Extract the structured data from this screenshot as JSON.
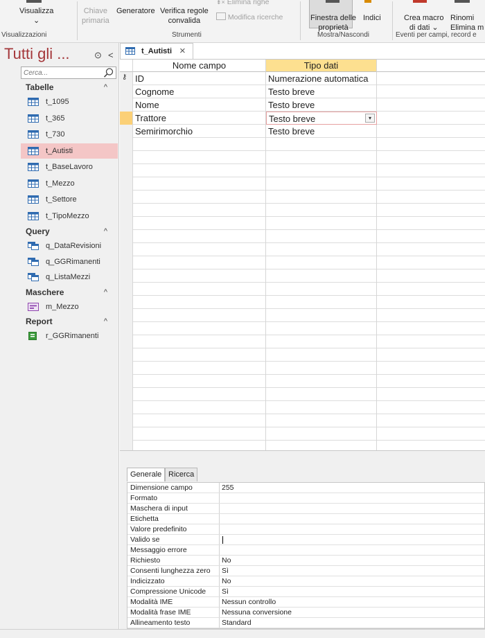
{
  "ribbon": {
    "visualizza": "Visualizza",
    "visualizza_arrow": "⌄",
    "chiave_line1": "Chiave",
    "chiave_line2": "primaria",
    "generatore": "Generatore",
    "verifica_line1": "Verifica regole",
    "verifica_line2": "convalida",
    "elimina_righe": "Elimina righe",
    "modifica_ricerche": "Modifica ricerche",
    "finestra_line1": "Finestra delle",
    "finestra_line2": "proprietà",
    "indici": "Indici",
    "crea_macro_line1": "Crea macro",
    "crea_macro_line2": "di dati ⌄",
    "rinomina": "Rinomi",
    "elimina_m": "Elimina m",
    "groups": {
      "visualizzazioni": "Visualizzazioni",
      "strumenti": "Strumenti",
      "mostra": "Mostra/Nascondi",
      "eventi": "Eventi per campi, record e"
    }
  },
  "nav": {
    "title": "Tutti gli ...",
    "search_placeholder": "Cerca...",
    "sections": [
      {
        "label": "Tabelle",
        "items": [
          "t_1095",
          "t_365",
          "t_730",
          "t_Autisti",
          "t_BaseLavoro",
          "t_Mezzo",
          "t_Settore",
          "t_TipoMezzo"
        ]
      },
      {
        "label": "Query",
        "items": [
          "q_DataRevisioni",
          "q_GGRimanenti",
          "q_ListaMezzi"
        ]
      },
      {
        "label": "Maschere",
        "items": [
          "m_Mezzo"
        ]
      },
      {
        "label": "Report",
        "items": [
          "r_GGRimanenti"
        ]
      }
    ],
    "selected": "t_Autisti"
  },
  "tab": {
    "label": "t_Autisti"
  },
  "grid": {
    "headers": {
      "name": "Nome campo",
      "type": "Tipo dati"
    },
    "rows": [
      {
        "name": "ID",
        "type": "Numerazione automatica",
        "key": true
      },
      {
        "name": "Cognome",
        "type": "Testo breve"
      },
      {
        "name": "Nome",
        "type": "Testo breve"
      },
      {
        "name": "Trattore",
        "type": "Testo breve",
        "current": true
      },
      {
        "name": "Semirimorchio",
        "type": "Testo breve"
      }
    ]
  },
  "props": {
    "tabs": [
      "Generale",
      "Ricerca"
    ],
    "active_tab": "Generale",
    "rows": [
      {
        "label": "Dimensione campo",
        "value": "255"
      },
      {
        "label": "Formato",
        "value": ""
      },
      {
        "label": "Maschera di input",
        "value": ""
      },
      {
        "label": "Etichetta",
        "value": ""
      },
      {
        "label": "Valore predefinito",
        "value": ""
      },
      {
        "label": "Valido se",
        "value": ""
      },
      {
        "label": "Messaggio errore",
        "value": ""
      },
      {
        "label": "Richiesto",
        "value": "No"
      },
      {
        "label": "Consenti lunghezza zero",
        "value": "Sì"
      },
      {
        "label": "Indicizzato",
        "value": "No"
      },
      {
        "label": "Compressione Unicode",
        "value": "Sì"
      },
      {
        "label": "Modalità IME",
        "value": "Nessun controllo"
      },
      {
        "label": "Modalità frase IME",
        "value": "Nessuna conversione"
      },
      {
        "label": "Allineamento testo",
        "value": "Standard"
      }
    ]
  }
}
